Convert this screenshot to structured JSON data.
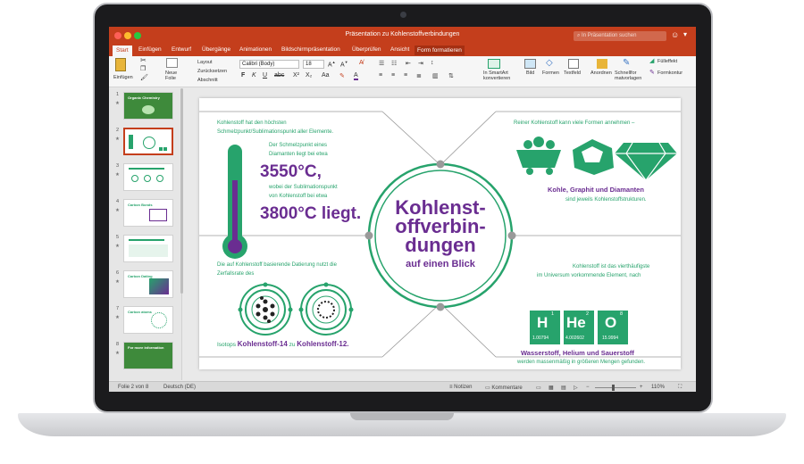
{
  "window": {
    "title": "Präsentation zu Kohlenstoffverbindungen",
    "search_placeholder": "In Präsentation suchen"
  },
  "tabs": [
    {
      "label": "Start",
      "active": true
    },
    {
      "label": "Einfügen"
    },
    {
      "label": "Entwurf"
    },
    {
      "label": "Übergänge"
    },
    {
      "label": "Animationen"
    },
    {
      "label": "Bildschirmpräsentation"
    },
    {
      "label": "Überprüfen"
    },
    {
      "label": "Ansicht"
    },
    {
      "label": "Form formatieren",
      "contextual": true
    }
  ],
  "ribbon": {
    "paste": "Einfügen",
    "new_slide": "Neue\nFolie",
    "layout": "Layout",
    "reset": "Zurücksetzen",
    "section": "Abschnitt",
    "font": "Calibri (Body)",
    "size": "18",
    "convert_smartart": "In SmartArt\nkonvertieren",
    "picture": "Bild",
    "shapes": "Formen",
    "textbox": "Textfeld",
    "arrange": "Anordnen",
    "quick_styles": "Schnellfor\nmatvorlagen",
    "fill": "Fülleffekt",
    "outline": "Formkontur"
  },
  "thumbnails": [
    {
      "num": "1",
      "title": "Organic Chemistry"
    },
    {
      "num": "2",
      "title": "",
      "selected": true
    },
    {
      "num": "3",
      "title": ""
    },
    {
      "num": "4",
      "title": "Carbon Bonds"
    },
    {
      "num": "5",
      "title": ""
    },
    {
      "num": "6",
      "title": "Carbon Dating"
    },
    {
      "num": "7",
      "title": "Carbon atoms"
    },
    {
      "num": "8",
      "title": "For more information"
    }
  ],
  "slide": {
    "center": {
      "l1": "Kohlenst-",
      "l2": "offverbin-",
      "l3": "dungen",
      "l4": "auf einen Blick"
    },
    "tl": {
      "p1": "Kohlenstoff hat den höchsten",
      "p2": "Schmelzpunkt/Sublimationspunkt aller Elemente.",
      "p3": "Der Schmelzpunkt eines",
      "p4": "Diamanten liegt bei etwa",
      "v1": "3550°C,",
      "p5": "wobei der Sublimationspunkt",
      "p6": "von Kohlenstoff bei etwa",
      "v2": "3800°C liegt."
    },
    "bl": {
      "p1": "Die auf Kohlenstoff basierende Datierung nutzt die",
      "p2": "Zerfallsrate des",
      "iso_pre": "Isotops",
      "iso_a": "Kohlenstoff-14",
      "iso_mid": "zu",
      "iso_b": "Kohlenstoff-12."
    },
    "tr": {
      "p1": "Reiner Kohlenstoff kann viele Formen annehmen –",
      "b1": "Kohle, Graphit und Diamanten",
      "p2": "sind jeweils Kohlenstoffstrukturen."
    },
    "br": {
      "p1": "Kohlenstoff ist das vierthäufigste",
      "p2": "im Universum vorkommende Element, nach",
      "b1": "Wasserstoff, Helium und Sauerstoff",
      "p3": "werden massenmäßig in größeren Mengen gefunden."
    },
    "elements": [
      {
        "sym": "H",
        "num": "1",
        "mass": "1.00794"
      },
      {
        "sym": "He",
        "num": "2",
        "mass": "4.002602"
      },
      {
        "sym": "O",
        "num": "8",
        "mass": "15.9994"
      }
    ]
  },
  "status": {
    "slide": "Folie 2 von 8",
    "lang": "Deutsch (DE)",
    "notes": "Notizen",
    "comments": "Kommentare",
    "zoom": "110%"
  },
  "colors": {
    "accent": "#c43e1c",
    "green": "#27a36c",
    "purple": "#6a2d91"
  }
}
